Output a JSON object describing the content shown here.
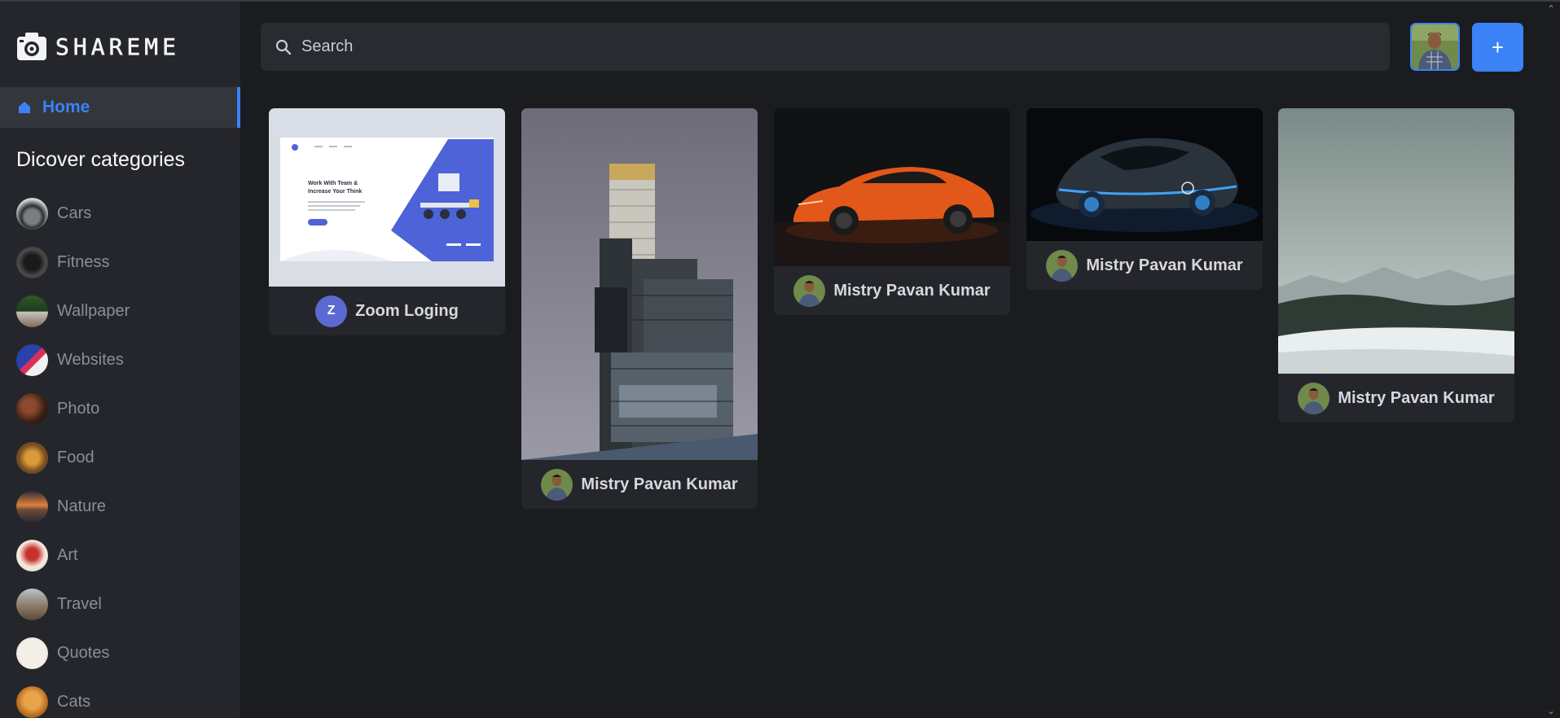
{
  "app": {
    "logo_text": "SHAREME"
  },
  "sidebar": {
    "home_label": "Home",
    "categories_heading": "Dicover categories",
    "categories": [
      {
        "label": "Cars",
        "icon": "cars-thumb"
      },
      {
        "label": "Fitness",
        "icon": "fitness-thumb"
      },
      {
        "label": "Wallpaper",
        "icon": "wallpaper-thumb"
      },
      {
        "label": "Websites",
        "icon": "websites-thumb"
      },
      {
        "label": "Photo",
        "icon": "photo-thumb"
      },
      {
        "label": "Food",
        "icon": "food-thumb"
      },
      {
        "label": "Nature",
        "icon": "nature-thumb"
      },
      {
        "label": "Art",
        "icon": "art-thumb"
      },
      {
        "label": "Travel",
        "icon": "travel-thumb"
      },
      {
        "label": "Quotes",
        "icon": "quotes-thumb"
      },
      {
        "label": "Cats",
        "icon": "cats-thumb"
      }
    ]
  },
  "header": {
    "search_placeholder": "Search",
    "add_label": "+"
  },
  "pins": [
    {
      "author": "Zoom Loging",
      "avatar_letter": "Z",
      "image": "website-mockup-image"
    },
    {
      "author": "Mistry Pavan Kumar",
      "image": "skyscraper-image"
    },
    {
      "author": "Mistry Pavan Kumar",
      "image": "orange-sports-car-image"
    },
    {
      "author": "Mistry Pavan Kumar",
      "image": "concept-car-image"
    },
    {
      "author": "Mistry Pavan Kumar",
      "image": "snowy-landscape-image"
    }
  ],
  "mockup": {
    "headline_1": "Work With Team &",
    "headline_2": "Increase Your Think"
  },
  "colors": {
    "accent": "#3b82f6",
    "background": "#1b1c20",
    "sidebar": "#25262b"
  }
}
